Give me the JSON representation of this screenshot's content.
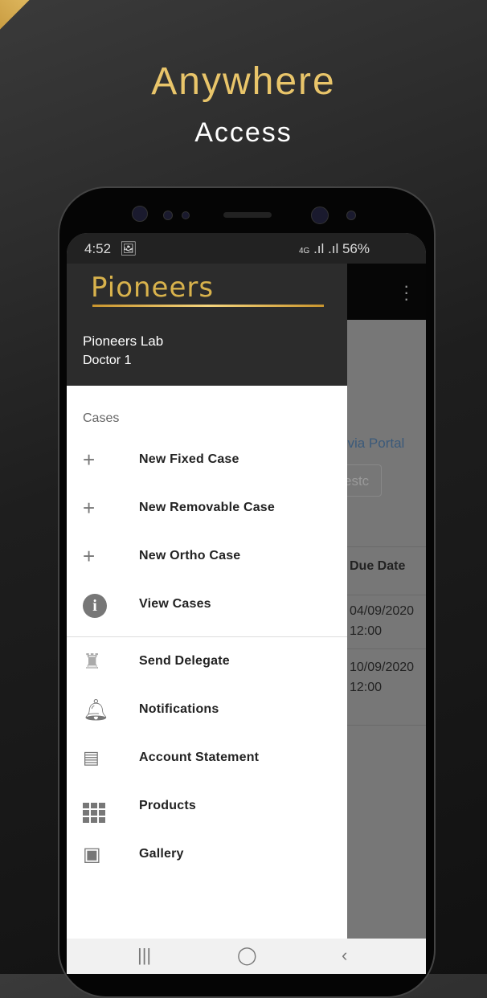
{
  "promo": {
    "title": "Anywhere",
    "subtitle": "Access"
  },
  "status": {
    "time": "4:52",
    "network": "4G",
    "battery": "56%"
  },
  "drawer": {
    "logo": "Pioneers",
    "user_name": "Pioneers Lab",
    "user_role": "Doctor 1",
    "section": "Cases",
    "cases": [
      {
        "label": "New Fixed Case",
        "icon": "plus-icon"
      },
      {
        "label": "New Removable Case",
        "icon": "plus-icon"
      },
      {
        "label": "New Ortho Case",
        "icon": "plus-icon"
      },
      {
        "label": "View Cases",
        "icon": "info-icon"
      }
    ],
    "others": [
      {
        "label": "Send Delegate",
        "icon": "delegate-icon"
      },
      {
        "label": "Notifications",
        "icon": "bell-icon"
      },
      {
        "label": "Account Statement",
        "icon": "statement-icon"
      },
      {
        "label": "Products",
        "icon": "grid-icon"
      },
      {
        "label": "Gallery",
        "icon": "gallery-icon"
      }
    ]
  },
  "background": {
    "link": "t via Portal",
    "input": "estc",
    "column": "Due Date",
    "rows": [
      {
        "date": "04/09/2020",
        "time": "12:00"
      },
      {
        "date": "10/09/2020",
        "time": "12:00"
      }
    ]
  },
  "accent": "#e9c56a"
}
